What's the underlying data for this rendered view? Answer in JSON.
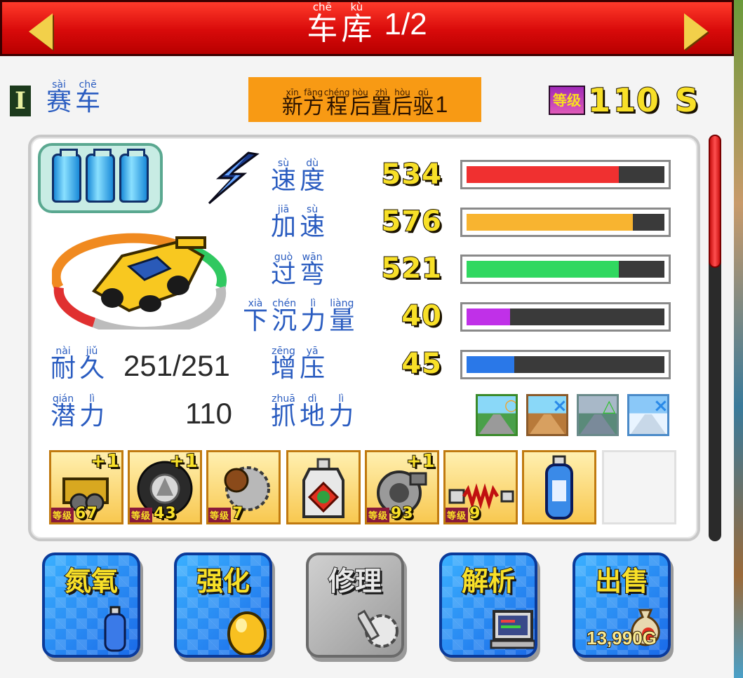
{
  "header": {
    "title_chars": [
      {
        "py": "chē",
        "hz": "车"
      },
      {
        "py": "kù",
        "hz": "库"
      }
    ],
    "page": "1/2"
  },
  "car": {
    "category_roman": "I",
    "category_chars": [
      {
        "py": "sài",
        "hz": "赛"
      },
      {
        "py": "chē",
        "hz": "车"
      }
    ],
    "name_chars": [
      {
        "py": "xīn",
        "hz": "新"
      },
      {
        "py": "fāng",
        "hz": "方"
      },
      {
        "py": "chéng",
        "hz": "程"
      },
      {
        "py": "hòu",
        "hz": "后"
      },
      {
        "py": "zhì",
        "hz": "置"
      },
      {
        "py": "hòu",
        "hz": "后"
      },
      {
        "py": "qū",
        "hz": "驱"
      }
    ],
    "name_suffix": "1",
    "level_badge": "等级",
    "level": "1",
    "level_max": "10",
    "rank": "S",
    "fuel_bottles": 3
  },
  "stats": [
    {
      "chars": [
        {
          "py": "sù",
          "hz": "速"
        },
        {
          "py": "dù",
          "hz": "度"
        }
      ],
      "value": "534",
      "fill": 0.77,
      "color": "#f03030"
    },
    {
      "chars": [
        {
          "py": "jiā",
          "hz": "加"
        },
        {
          "py": "sù",
          "hz": "速"
        }
      ],
      "value": "576",
      "fill": 0.84,
      "color": "#f8b430"
    },
    {
      "chars": [
        {
          "py": "guò",
          "hz": "过"
        },
        {
          "py": "wān",
          "hz": "弯"
        }
      ],
      "value": "521",
      "fill": 0.77,
      "color": "#30d860"
    },
    {
      "chars": [
        {
          "py": "xià",
          "hz": "下"
        },
        {
          "py": "chén",
          "hz": "沉"
        },
        {
          "py": "lì",
          "hz": "力"
        },
        {
          "py": "liàng",
          "hz": "量"
        }
      ],
      "value": "40",
      "fill": 0.22,
      "color": "#c030e8"
    },
    {
      "chars": [
        {
          "py": "zēng",
          "hz": "增"
        },
        {
          "py": "yā",
          "hz": "压"
        }
      ],
      "value": "45",
      "fill": 0.24,
      "color": "#2a78e8"
    }
  ],
  "info": {
    "durability_chars": [
      {
        "py": "nài",
        "hz": "耐"
      },
      {
        "py": "jiǔ",
        "hz": "久"
      }
    ],
    "durability": "251/251",
    "potential_chars": [
      {
        "py": "qián",
        "hz": "潜"
      },
      {
        "py": "lì",
        "hz": "力"
      }
    ],
    "potential": "110",
    "grip_chars": [
      {
        "py": "zhuā",
        "hz": "抓"
      },
      {
        "py": "dì",
        "hz": "地"
      },
      {
        "py": "lì",
        "hz": "力"
      }
    ]
  },
  "track_suitability": [
    {
      "terrain": "paved",
      "mark": "○",
      "mark_color": "#f8a020"
    },
    {
      "terrain": "dirt",
      "mark": "×",
      "mark_color": "#2a8ae8"
    },
    {
      "terrain": "wet",
      "mark": "△",
      "mark_color": "#30c030"
    },
    {
      "terrain": "snow",
      "mark": "×",
      "mark_color": "#2a8ae8"
    }
  ],
  "parts": [
    {
      "icon": "engine-icon",
      "plus": "+1",
      "level_tag": "等级",
      "level": "67"
    },
    {
      "icon": "tire-icon",
      "plus": "+1",
      "level_tag": "等级",
      "level": "43"
    },
    {
      "icon": "gear-icon",
      "plus": "",
      "level_tag": "等级",
      "level": "7"
    },
    {
      "icon": "oil-can-icon",
      "plus": "",
      "level_tag": "",
      "level": ""
    },
    {
      "icon": "turbo-icon",
      "plus": "+1",
      "level_tag": "等级",
      "level": "93"
    },
    {
      "icon": "suspension-icon",
      "plus": "",
      "level_tag": "等级",
      "level": "9"
    },
    {
      "icon": "nitro-bottle-icon",
      "plus": "",
      "level_tag": "",
      "level": ""
    },
    {
      "icon": "",
      "plus": "",
      "level_tag": "",
      "level": ""
    }
  ],
  "actions": [
    {
      "label": "氮氧",
      "icon": "nitro-bottle-icon",
      "enabled": true,
      "price": ""
    },
    {
      "label": "强化",
      "icon": "egg-icon",
      "enabled": true,
      "price": ""
    },
    {
      "label": "修理",
      "icon": "wrench-icon",
      "enabled": false,
      "price": ""
    },
    {
      "label": "解析",
      "icon": "computer-icon",
      "enabled": true,
      "price": ""
    },
    {
      "label": "出售",
      "icon": "money-bag-icon",
      "enabled": true,
      "price": "13,990G"
    }
  ],
  "colors": {
    "accent_red": "#e01010",
    "label_blue": "#2a5cc0",
    "name_orange": "#f89a14"
  }
}
